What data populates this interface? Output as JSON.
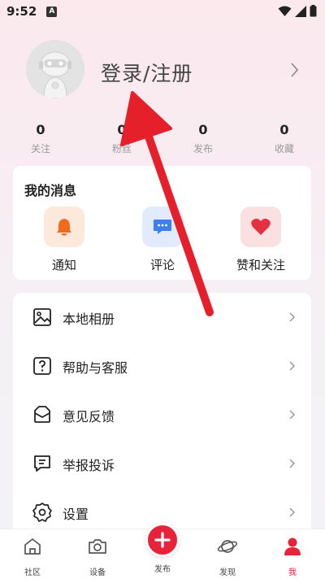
{
  "status_bar": {
    "time": "9:52",
    "app_icon_letter": "A"
  },
  "profile": {
    "login_text": "登录/注册"
  },
  "stats": [
    {
      "value": "0",
      "label": "关注"
    },
    {
      "value": "0",
      "label": "粉丝"
    },
    {
      "value": "0",
      "label": "发布"
    },
    {
      "value": "0",
      "label": "收藏"
    }
  ],
  "messages": {
    "title": "我的消息",
    "items": [
      {
        "label": "通知",
        "icon": "bell-icon",
        "color": "#f26b1d",
        "bg": "#fde9dc"
      },
      {
        "label": "评论",
        "icon": "comment-icon",
        "color": "#3d7ff3",
        "bg": "#e1ebfd"
      },
      {
        "label": "赞和关注",
        "icon": "heart-icon",
        "color": "#e5303f",
        "bg": "#fbe0e2"
      }
    ]
  },
  "menu": [
    {
      "label": "本地相册",
      "icon": "image-icon"
    },
    {
      "label": "帮助与客服",
      "icon": "help-icon"
    },
    {
      "label": "意见反馈",
      "icon": "feedback-icon"
    },
    {
      "label": "举报投诉",
      "icon": "report-icon"
    },
    {
      "label": "设置",
      "icon": "settings-icon"
    }
  ],
  "bottom_nav": [
    {
      "label": "社区",
      "icon": "home-icon"
    },
    {
      "label": "设备",
      "icon": "camera-icon"
    },
    {
      "label": "发布",
      "icon": "plus-icon"
    },
    {
      "label": "发现",
      "icon": "planet-icon"
    },
    {
      "label": "我",
      "icon": "person-icon",
      "active": true
    }
  ],
  "colors": {
    "accent": "#e8223a",
    "arrow": "#e5202a"
  }
}
